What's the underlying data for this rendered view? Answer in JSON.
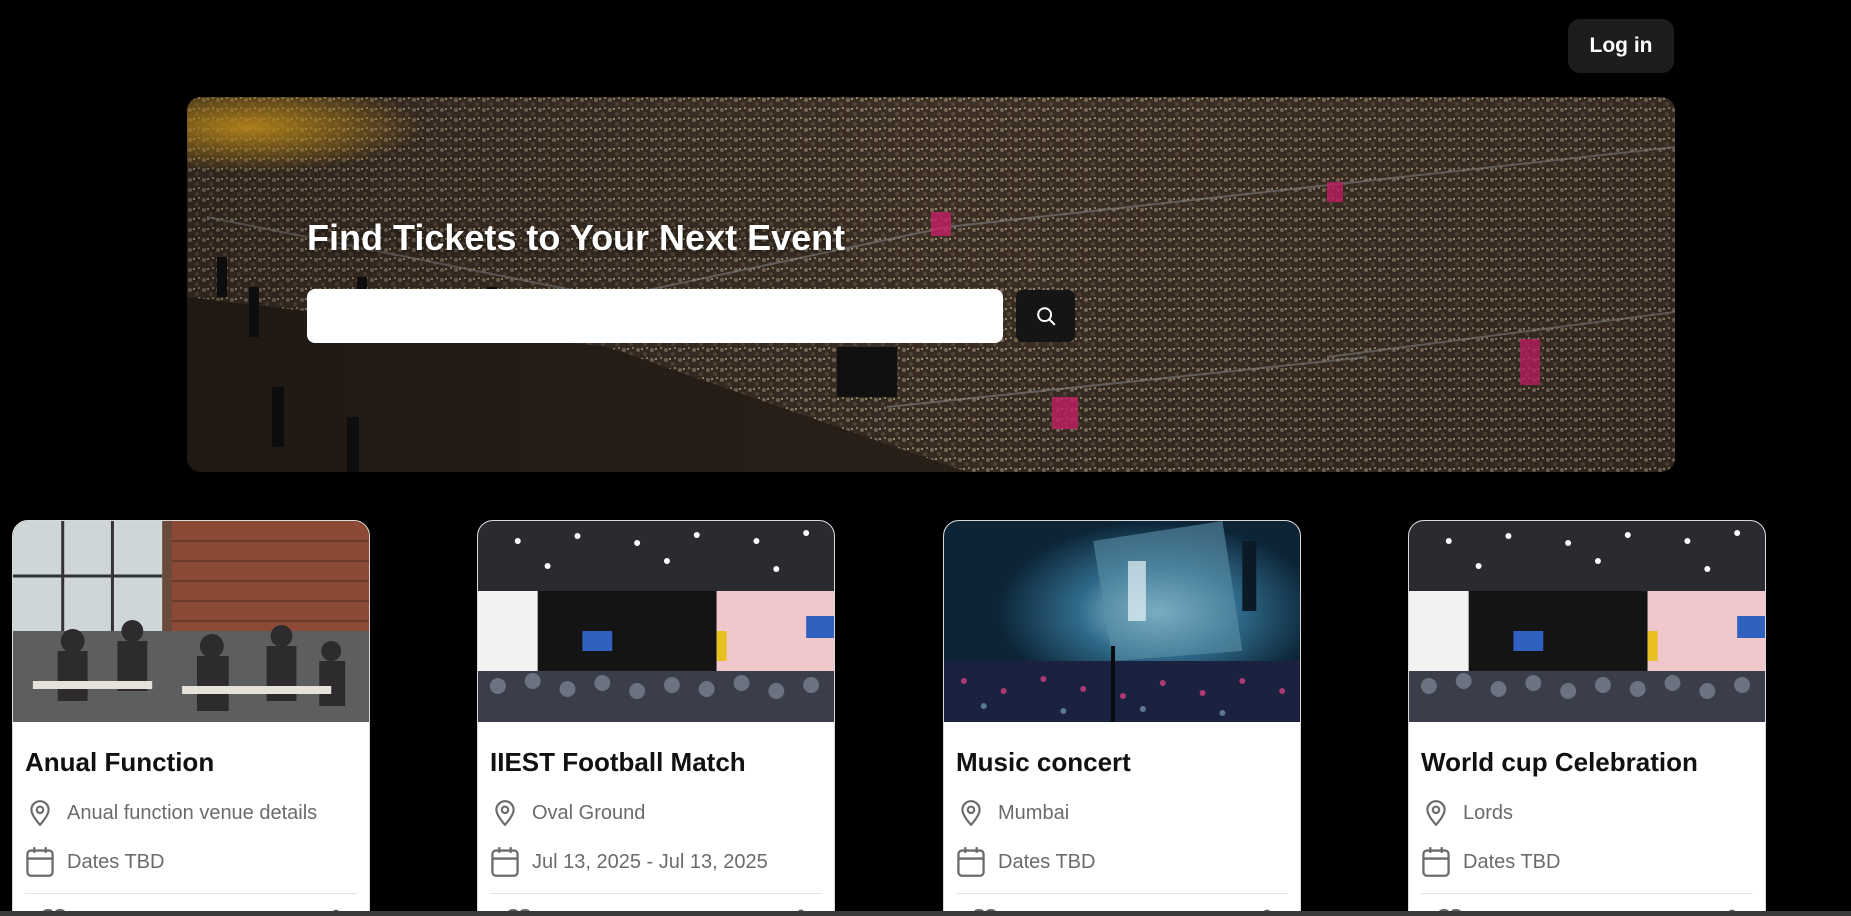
{
  "header": {
    "login_label": "Log in"
  },
  "hero": {
    "title": "Find Tickets to Your Next Event",
    "search_placeholder": "",
    "search_value": ""
  },
  "events": [
    {
      "title": "Anual Function",
      "location": "Anual function venue details",
      "dates": "Dates TBD"
    },
    {
      "title": "IIEST Football Match",
      "location": "Oval Ground",
      "dates": "Jul 13, 2025 - Jul 13, 2025"
    },
    {
      "title": "Music concert",
      "location": "Mumbai",
      "dates": "Dates TBD"
    },
    {
      "title": "World cup Celebration",
      "location": "Lords",
      "dates": "Dates TBD"
    }
  ],
  "icons": {
    "search": "search-icon",
    "location": "map-pin-icon",
    "date": "calendar-icon",
    "like": "heart-icon",
    "share": "share-icon"
  },
  "colors": {
    "background": "#000000",
    "card": "#ffffff",
    "button": "#1d1d1d",
    "meta_text": "#6b6b6b"
  }
}
